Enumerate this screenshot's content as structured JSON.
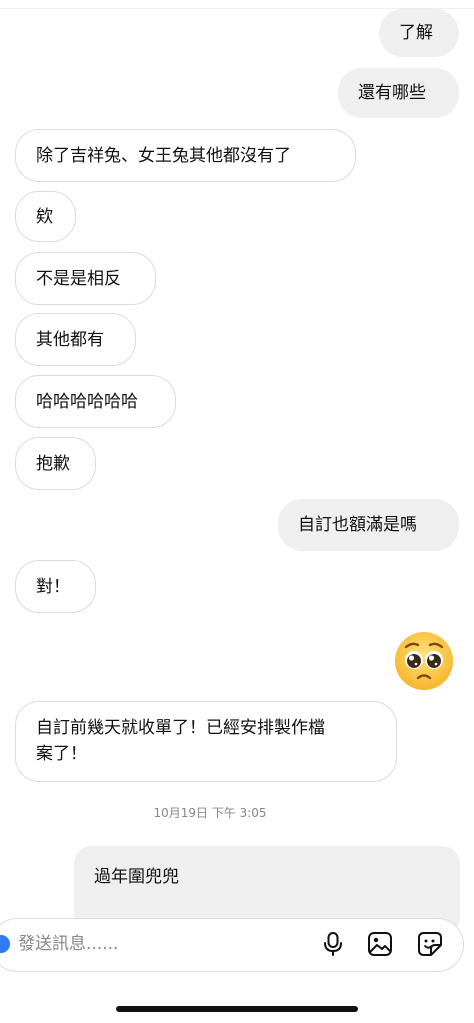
{
  "messages": {
    "m1": "了解",
    "m2": "還有哪些",
    "m3": "除了吉祥兔、女王兔其他都沒有了",
    "m4": "欸",
    "m5": "不是是相反",
    "m6": "其他都有",
    "m7": "哈哈哈哈哈哈",
    "m8": "抱歉",
    "m9": "自訂也額滿是嗎",
    "m10": "對！",
    "m11_line1": "自訂前幾天就收單了！已經安排製作檔",
    "m11_line2": "案了！"
  },
  "emoji": "pleading-face",
  "timestamp": "10月19日 下午 3:05",
  "reply_preview": "過年圍兜兜",
  "composer": {
    "placeholder": "發送訊息......"
  },
  "icons": [
    "microphone-icon",
    "image-icon",
    "sticker-icon"
  ],
  "colors": {
    "sent_bubble": "#efefef",
    "received_border": "#dcdcdc",
    "accent": "#2f7cf6"
  }
}
